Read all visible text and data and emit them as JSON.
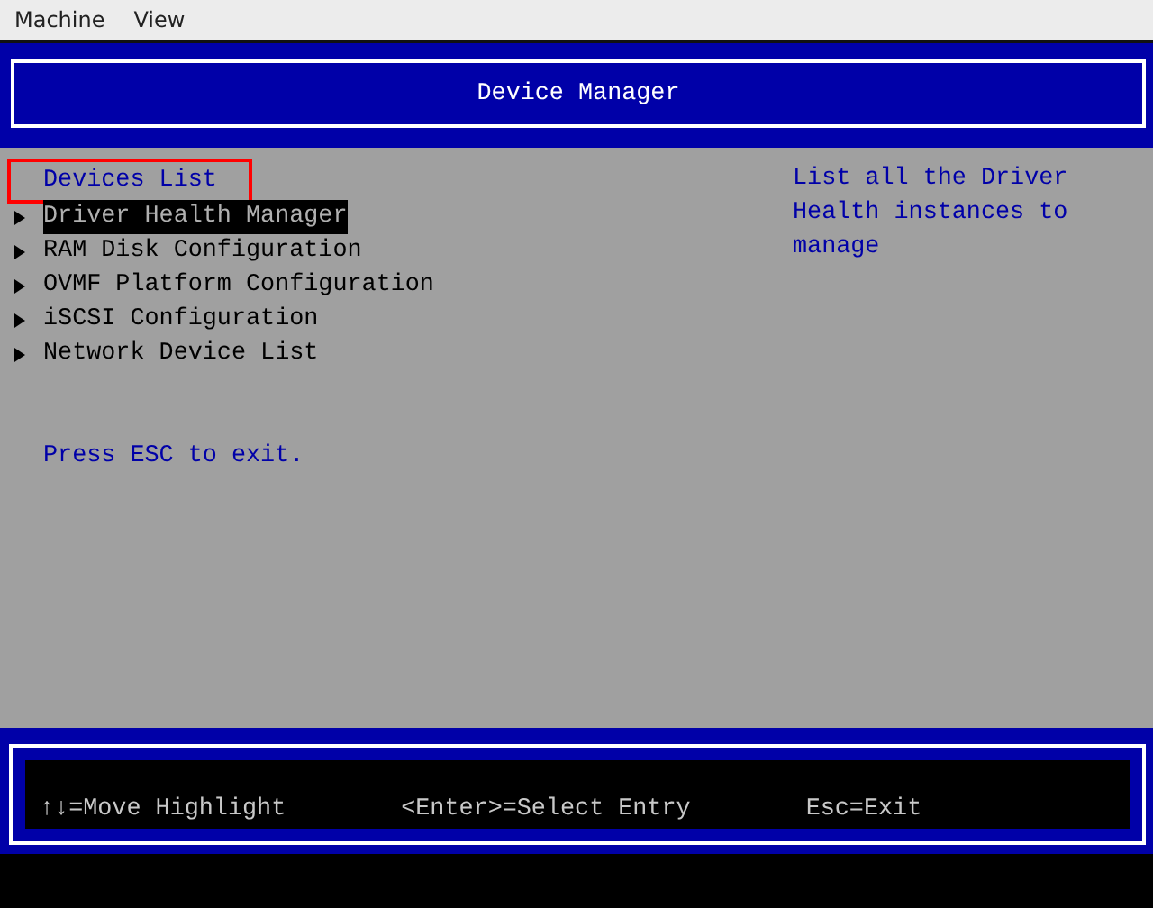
{
  "menu_bar": [
    {
      "label": "Machine"
    },
    {
      "label": "View"
    }
  ],
  "title": "Device Manager",
  "section": {
    "label": "Devices List",
    "outlined": true
  },
  "items": [
    {
      "label": "Driver Health Manager",
      "selected": true
    },
    {
      "label": "RAM Disk Configuration",
      "selected": false
    },
    {
      "label": "OVMF Platform Configuration",
      "selected": false
    },
    {
      "label": "iSCSI Configuration",
      "selected": false
    },
    {
      "label": "Network Device List",
      "selected": false
    }
  ],
  "hint": "Press ESC to exit.",
  "help_text": "List all the Driver Health instances to manage",
  "footer_keys": [
    "↑↓=Move Highlight",
    "<Enter>=Select Entry",
    "Esc=Exit"
  ]
}
